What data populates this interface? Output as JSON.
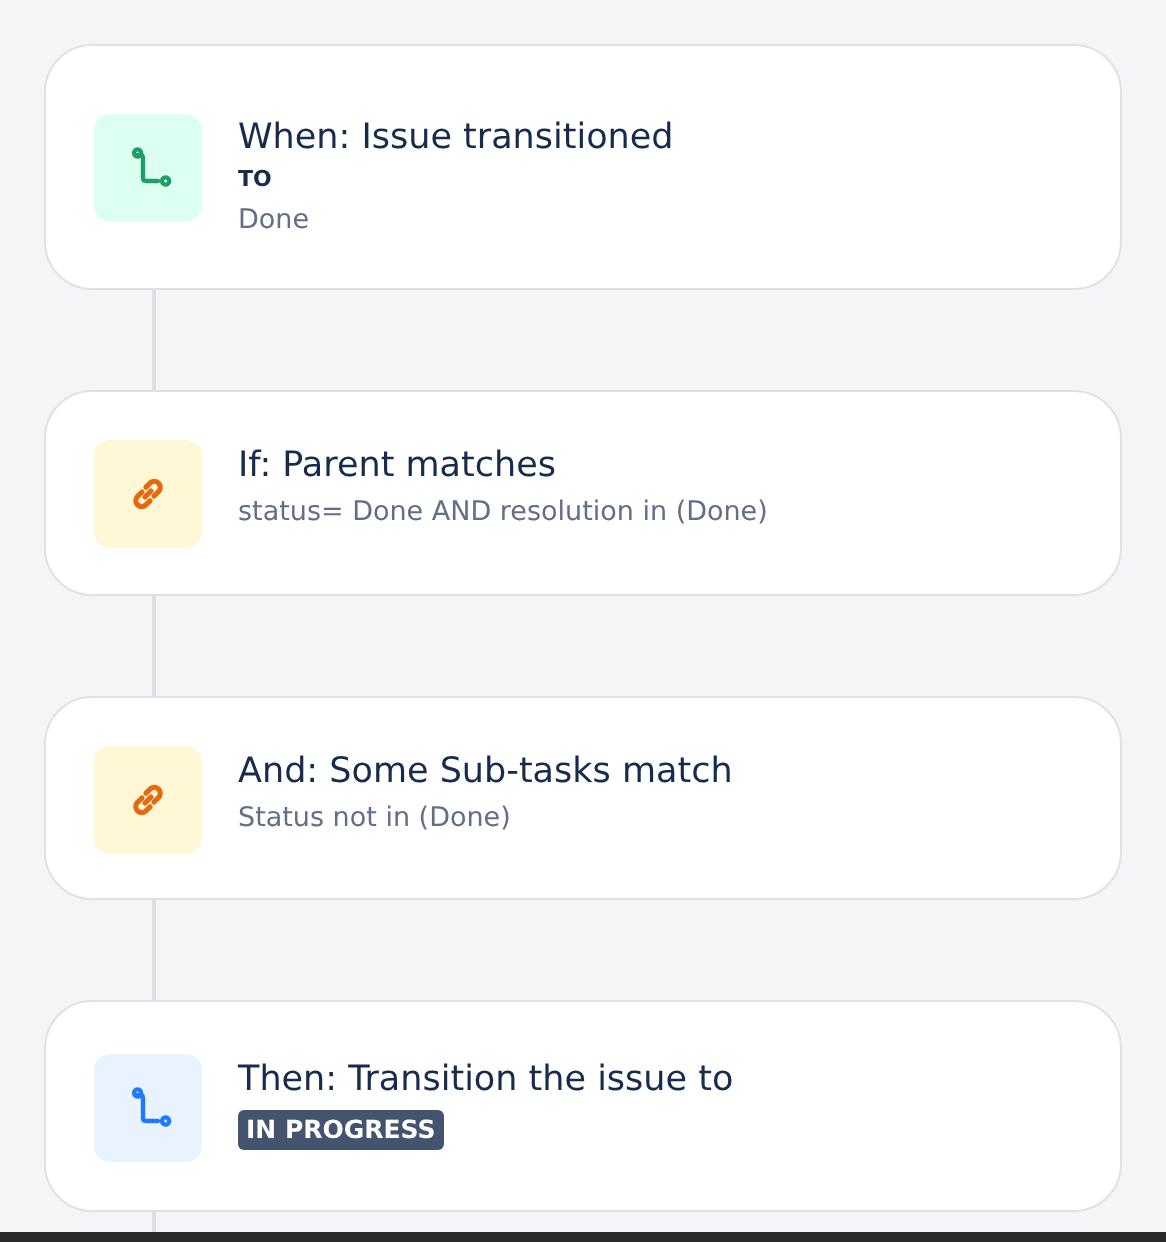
{
  "steps": [
    {
      "kind": "trigger",
      "title": "When: Issue transitioned",
      "lines": [
        {
          "kind": "label",
          "text": "TO"
        },
        {
          "kind": "detail",
          "text": "Done"
        }
      ]
    },
    {
      "kind": "condition",
      "title": "If: Parent matches",
      "lines": [
        {
          "kind": "detail",
          "text": "status= Done AND resolution in (Done)"
        }
      ]
    },
    {
      "kind": "condition",
      "title": "And: Some Sub-tasks match",
      "lines": [
        {
          "kind": "detail",
          "text": "Status not in (Done)"
        }
      ]
    },
    {
      "kind": "action",
      "title": "Then: Transition the issue to",
      "lines": [
        {
          "kind": "lozenge",
          "text": "IN PROGRESS"
        }
      ]
    }
  ]
}
